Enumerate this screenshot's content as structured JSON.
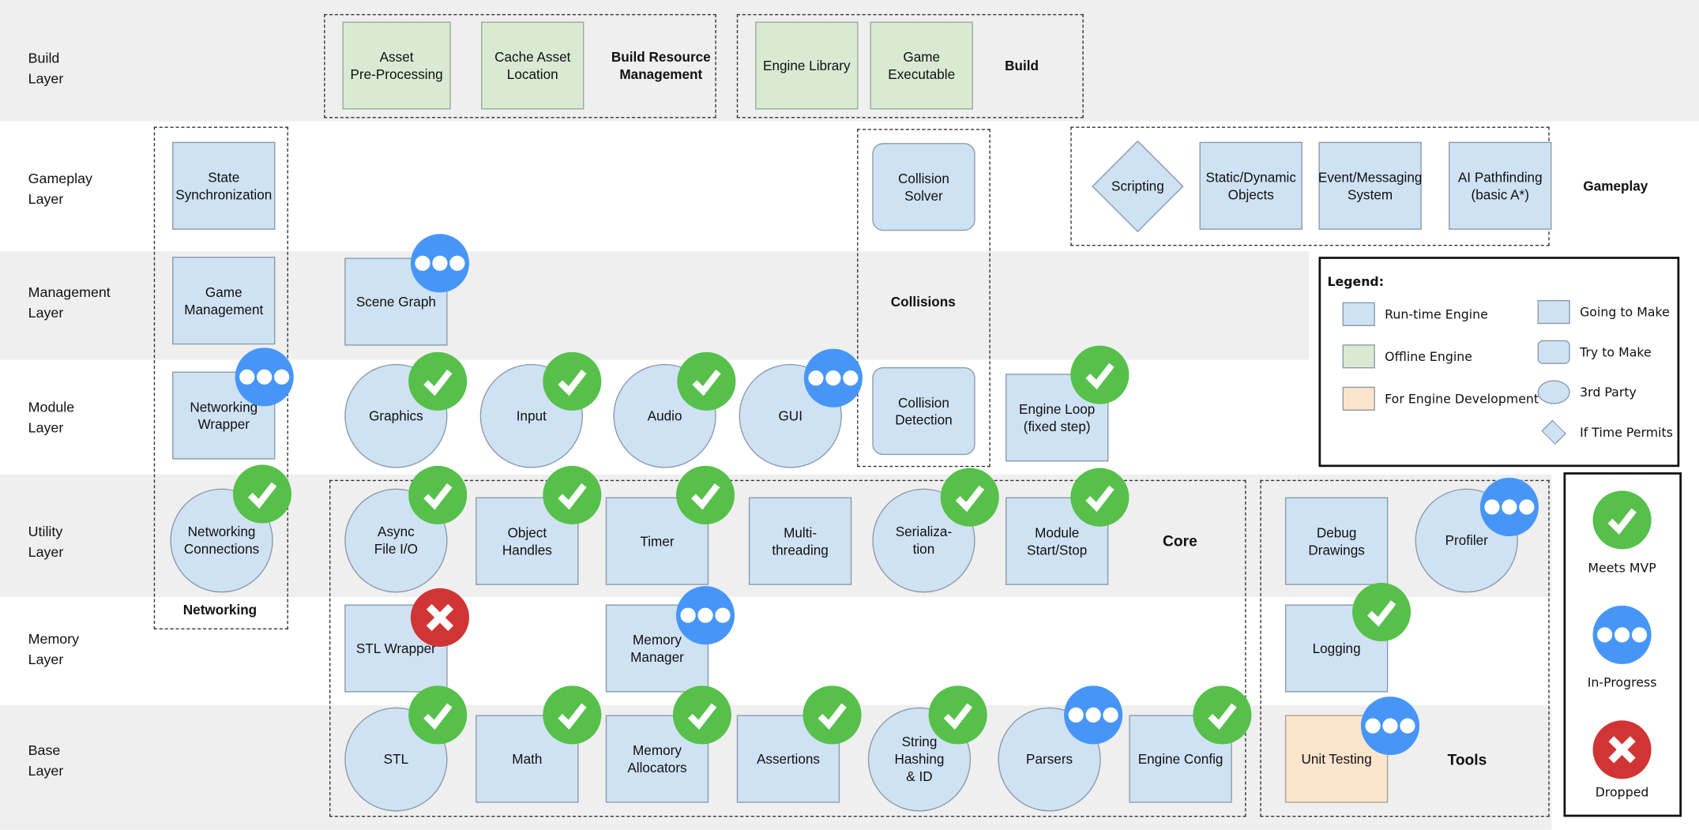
{
  "colors": {
    "runtime": "#cfe2f3",
    "offline": "#d9ead3",
    "dev": "#fce5cd",
    "done": "#56c04a",
    "in_progress": "#4796f7",
    "dropped": "#d13434",
    "band": "#efefef"
  },
  "layers": [
    "Build\nLayer",
    "Gameplay\nLayer",
    "Management\nLayer",
    "Module\nLayer",
    "Utility\nLayer",
    "Memory\nLayer",
    "Base\nLayer"
  ],
  "groups": [
    "Build Resource\nManagement",
    "Build",
    "Networking",
    "Collisions",
    "Gameplay",
    "Core",
    "Tools"
  ],
  "nodes": [
    {
      "label": "Asset\nPre-Processing",
      "shape": "square",
      "kind": "offline",
      "status": ""
    },
    {
      "label": "Cache Asset\nLocation",
      "shape": "square",
      "kind": "offline",
      "status": ""
    },
    {
      "label": "Engine Library",
      "shape": "square",
      "kind": "offline",
      "status": ""
    },
    {
      "label": "Game\nExecutable",
      "shape": "square",
      "kind": "offline",
      "status": ""
    },
    {
      "label": "State\nSynchronization",
      "shape": "square",
      "kind": "runtime",
      "status": ""
    },
    {
      "label": "Game\nManagement",
      "shape": "square",
      "kind": "runtime",
      "status": ""
    },
    {
      "label": "Networking\nWrapper",
      "shape": "square",
      "kind": "runtime",
      "status": "in-progress"
    },
    {
      "label": "Networking\nConnections",
      "shape": "circle",
      "kind": "runtime",
      "status": "done"
    },
    {
      "label": "Scene Graph",
      "shape": "square",
      "kind": "runtime",
      "status": "in-progress"
    },
    {
      "label": "Collision\nSolver",
      "shape": "rounded",
      "kind": "runtime",
      "status": ""
    },
    {
      "label": "Collision\nDetection",
      "shape": "rounded",
      "kind": "runtime",
      "status": ""
    },
    {
      "label": "Scripting",
      "shape": "diamond",
      "kind": "runtime",
      "status": ""
    },
    {
      "label": "Static/Dynamic\nObjects",
      "shape": "square",
      "kind": "runtime",
      "status": ""
    },
    {
      "label": "Event/Messaging\nSystem",
      "shape": "square",
      "kind": "runtime",
      "status": ""
    },
    {
      "label": "AI Pathfinding\n(basic A*)",
      "shape": "square",
      "kind": "runtime",
      "status": ""
    },
    {
      "label": "Graphics",
      "shape": "circle",
      "kind": "runtime",
      "status": "done"
    },
    {
      "label": "Input",
      "shape": "circle",
      "kind": "runtime",
      "status": "done"
    },
    {
      "label": "Audio",
      "shape": "circle",
      "kind": "runtime",
      "status": "done"
    },
    {
      "label": "GUI",
      "shape": "circle",
      "kind": "runtime",
      "status": "in-progress"
    },
    {
      "label": "Engine Loop\n(fixed step)",
      "shape": "square",
      "kind": "runtime",
      "status": "done"
    },
    {
      "label": "Async\nFile I/O",
      "shape": "circle",
      "kind": "runtime",
      "status": "done"
    },
    {
      "label": "Object\nHandles",
      "shape": "square",
      "kind": "runtime",
      "status": "done"
    },
    {
      "label": "Timer",
      "shape": "square",
      "kind": "runtime",
      "status": "done"
    },
    {
      "label": "Multi-\nthreading",
      "shape": "square",
      "kind": "runtime",
      "status": ""
    },
    {
      "label": "Serializa-\ntion",
      "shape": "circle",
      "kind": "runtime",
      "status": "done"
    },
    {
      "label": "Module\nStart/Stop",
      "shape": "square",
      "kind": "runtime",
      "status": "done"
    },
    {
      "label": "STL Wrapper",
      "shape": "square",
      "kind": "runtime",
      "status": "dropped"
    },
    {
      "label": "Memory\nManager",
      "shape": "square",
      "kind": "runtime",
      "status": "in-progress"
    },
    {
      "label": "STL",
      "shape": "circle",
      "kind": "runtime",
      "status": "done"
    },
    {
      "label": "Math",
      "shape": "square",
      "kind": "runtime",
      "status": "done"
    },
    {
      "label": "Memory\nAllocators",
      "shape": "square",
      "kind": "runtime",
      "status": "done"
    },
    {
      "label": "Assertions",
      "shape": "square",
      "kind": "runtime",
      "status": "done"
    },
    {
      "label": "String\nHashing\n& ID",
      "shape": "circle",
      "kind": "runtime",
      "status": "done"
    },
    {
      "label": "Parsers",
      "shape": "circle",
      "kind": "runtime",
      "status": "in-progress"
    },
    {
      "label": "Engine Config",
      "shape": "square",
      "kind": "runtime",
      "status": "done"
    },
    {
      "label": "Debug\nDrawings",
      "shape": "square",
      "kind": "runtime",
      "status": ""
    },
    {
      "label": "Profiler",
      "shape": "circle",
      "kind": "runtime",
      "status": "in-progress"
    },
    {
      "label": "Logging",
      "shape": "square",
      "kind": "runtime",
      "status": "done"
    },
    {
      "label": "Unit Testing",
      "shape": "square",
      "kind": "dev",
      "status": "in-progress"
    }
  ],
  "legend": {
    "title": "Legend:",
    "kinds": [
      {
        "label": "Run-time Engine",
        "kind": "runtime"
      },
      {
        "label": "Offline Engine",
        "kind": "offline"
      },
      {
        "label": "For Engine Development",
        "kind": "dev"
      }
    ],
    "shapes": [
      {
        "label": "Going to Make",
        "shape": "square"
      },
      {
        "label": "Try to Make",
        "shape": "rounded"
      },
      {
        "label": "3rd Party",
        "shape": "circle"
      },
      {
        "label": "If Time Permits",
        "shape": "diamond"
      }
    ]
  },
  "status_legend": [
    {
      "label": "Meets MVP",
      "status": "done"
    },
    {
      "label": "In-Progress",
      "status": "in-progress"
    },
    {
      "label": "Dropped",
      "status": "dropped"
    }
  ]
}
